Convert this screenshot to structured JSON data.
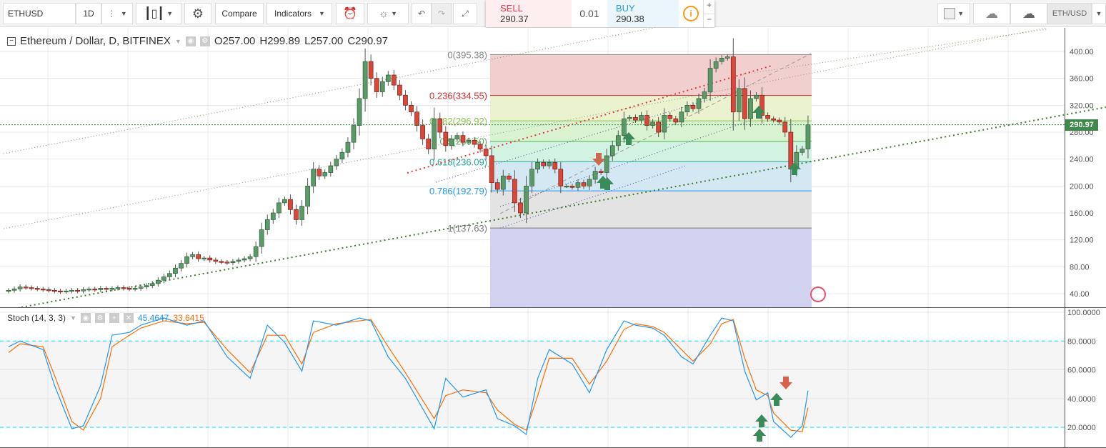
{
  "toolbar": {
    "symbol": "ETHUSD",
    "interval": "1D",
    "compare": "Compare",
    "indicators": "Indicators",
    "symbol_right": "ETH/USD"
  },
  "quote": {
    "sell_label": "SELL",
    "sell_price": "290.37",
    "spread": "0.01",
    "buy_label": "BUY",
    "buy_price": "290.38"
  },
  "legend": {
    "title": "Ethereum / Dollar, D, BITFINEX",
    "open": "O257.00",
    "high": "H299.89",
    "low": "L257.00",
    "close": "C290.97"
  },
  "stoch": {
    "title": "Stoch (14, 3, 3)",
    "k_value": "45.4647",
    "d_value": "33.6415",
    "k_color": "#2196f3",
    "d_color": "#ff6d00"
  },
  "current_price": "290.97",
  "price_axis": [
    "400.00",
    "360.00",
    "320.00",
    "280.00",
    "240.00",
    "200.00",
    "160.00",
    "120.00",
    "80.00",
    "40.00"
  ],
  "stoch_axis": [
    "100.0000",
    "80.0000",
    "60.0000",
    "40.0000",
    "20.0000"
  ],
  "fib": [
    {
      "label": "0(395.38)",
      "level": 395.38,
      "color": "#888888",
      "fill": "#f2cfcf"
    },
    {
      "label": "0.236(334.55)",
      "level": 334.55,
      "color": "#d32f2f",
      "fill": "#eaf2cf"
    },
    {
      "label": "0.382(296.92)",
      "level": 296.92,
      "color": "#8bc34a",
      "fill": "#d9f2cf"
    },
    {
      "label": "0.5(266.50)",
      "level": 266.5,
      "color": "#4caf50",
      "fill": "#d2f2e2"
    },
    {
      "label": "0.618(236.09)",
      "level": 236.09,
      "color": "#26a69a",
      "fill": "#d3e8f3"
    },
    {
      "label": "0.786(192.79)",
      "level": 192.79,
      "color": "#2196f3",
      "fill": "#e3e3e3"
    },
    {
      "label": "1(137.63)",
      "level": 137.63,
      "color": "#777777",
      "fill": "#d1d1f0"
    }
  ],
  "chart_data": {
    "type": "candlestick",
    "ylim": [
      20,
      420
    ],
    "closes": [
      45,
      47,
      50,
      49,
      48,
      47,
      46,
      45,
      44,
      43,
      44,
      45,
      44,
      46,
      47,
      46,
      48,
      47,
      48,
      49,
      48,
      47,
      48,
      50,
      52,
      55,
      60,
      65,
      70,
      78,
      85,
      95,
      98,
      92,
      93,
      90,
      88,
      87,
      86,
      88,
      90,
      92,
      95,
      110,
      135,
      150,
      160,
      175,
      180,
      165,
      150,
      170,
      200,
      225,
      215,
      220,
      230,
      240,
      250,
      265,
      290,
      330,
      385,
      360,
      340,
      355,
      365,
      350,
      335,
      320,
      310,
      290,
      270,
      255,
      300,
      280,
      260,
      270,
      275,
      265,
      268,
      262,
      255,
      245,
      205,
      195,
      215,
      210,
      175,
      160,
      200,
      225,
      235,
      230,
      235,
      225,
      200,
      200,
      198,
      205,
      200,
      210,
      222,
      220,
      245,
      260,
      275,
      300,
      302,
      298,
      305,
      290,
      295,
      280,
      305,
      300,
      295,
      310,
      320,
      315,
      330,
      340,
      375,
      385,
      390,
      392,
      310,
      345,
      300,
      330,
      335,
      305,
      300,
      298,
      295,
      280,
      225,
      250,
      255,
      290.97
    ],
    "stoch_k": [
      [
        0,
        76
      ],
      [
        2,
        80
      ],
      [
        6,
        74
      ],
      [
        8,
        49
      ],
      [
        11,
        19
      ],
      [
        13,
        21
      ],
      [
        16,
        49
      ],
      [
        18,
        84
      ],
      [
        21,
        86
      ],
      [
        23,
        91
      ],
      [
        27,
        96
      ],
      [
        31,
        91
      ],
      [
        34,
        94
      ],
      [
        38,
        69
      ],
      [
        42,
        54
      ],
      [
        45,
        91
      ],
      [
        48,
        79
      ],
      [
        51,
        59
      ],
      [
        53,
        94
      ],
      [
        57,
        91
      ],
      [
        61,
        96
      ],
      [
        63,
        94
      ],
      [
        66,
        69
      ],
      [
        69,
        54
      ],
      [
        74,
        19
      ],
      [
        76,
        54
      ],
      [
        79,
        41
      ],
      [
        83,
        46
      ],
      [
        85,
        26
      ],
      [
        88,
        21
      ],
      [
        90,
        15
      ],
      [
        92,
        54
      ],
      [
        94,
        74
      ],
      [
        98,
        64
      ],
      [
        101,
        44
      ],
      [
        104,
        74
      ],
      [
        107,
        94
      ],
      [
        109,
        91
      ],
      [
        112,
        89
      ],
      [
        114,
        84
      ],
      [
        117,
        69
      ],
      [
        119,
        64
      ],
      [
        122,
        84
      ],
      [
        124,
        96
      ],
      [
        126,
        94
      ],
      [
        128,
        59
      ],
      [
        130,
        39
      ],
      [
        132,
        44
      ],
      [
        133,
        24
      ],
      [
        136,
        13
      ],
      [
        138,
        21
      ],
      [
        139,
        45.46
      ]
    ],
    "stoch_d": [
      [
        0,
        72
      ],
      [
        2,
        78
      ],
      [
        6,
        76
      ],
      [
        8,
        56
      ],
      [
        11,
        24
      ],
      [
        13,
        18
      ],
      [
        16,
        40
      ],
      [
        18,
        76
      ],
      [
        21,
        84
      ],
      [
        23,
        89
      ],
      [
        27,
        94
      ],
      [
        31,
        92
      ],
      [
        34,
        93
      ],
      [
        38,
        74
      ],
      [
        42,
        58
      ],
      [
        45,
        84
      ],
      [
        48,
        84
      ],
      [
        51,
        64
      ],
      [
        53,
        86
      ],
      [
        57,
        92
      ],
      [
        61,
        94
      ],
      [
        63,
        95
      ],
      [
        66,
        76
      ],
      [
        69,
        58
      ],
      [
        74,
        26
      ],
      [
        76,
        42
      ],
      [
        79,
        46
      ],
      [
        83,
        44
      ],
      [
        85,
        32
      ],
      [
        88,
        22
      ],
      [
        90,
        18
      ],
      [
        92,
        42
      ],
      [
        94,
        68
      ],
      [
        98,
        68
      ],
      [
        101,
        50
      ],
      [
        104,
        66
      ],
      [
        107,
        88
      ],
      [
        109,
        92
      ],
      [
        112,
        90
      ],
      [
        114,
        86
      ],
      [
        117,
        74
      ],
      [
        119,
        66
      ],
      [
        122,
        78
      ],
      [
        124,
        92
      ],
      [
        126,
        95
      ],
      [
        128,
        68
      ],
      [
        130,
        46
      ],
      [
        132,
        42
      ],
      [
        133,
        30
      ],
      [
        136,
        18
      ],
      [
        138,
        17
      ],
      [
        139,
        33.64
      ]
    ]
  }
}
